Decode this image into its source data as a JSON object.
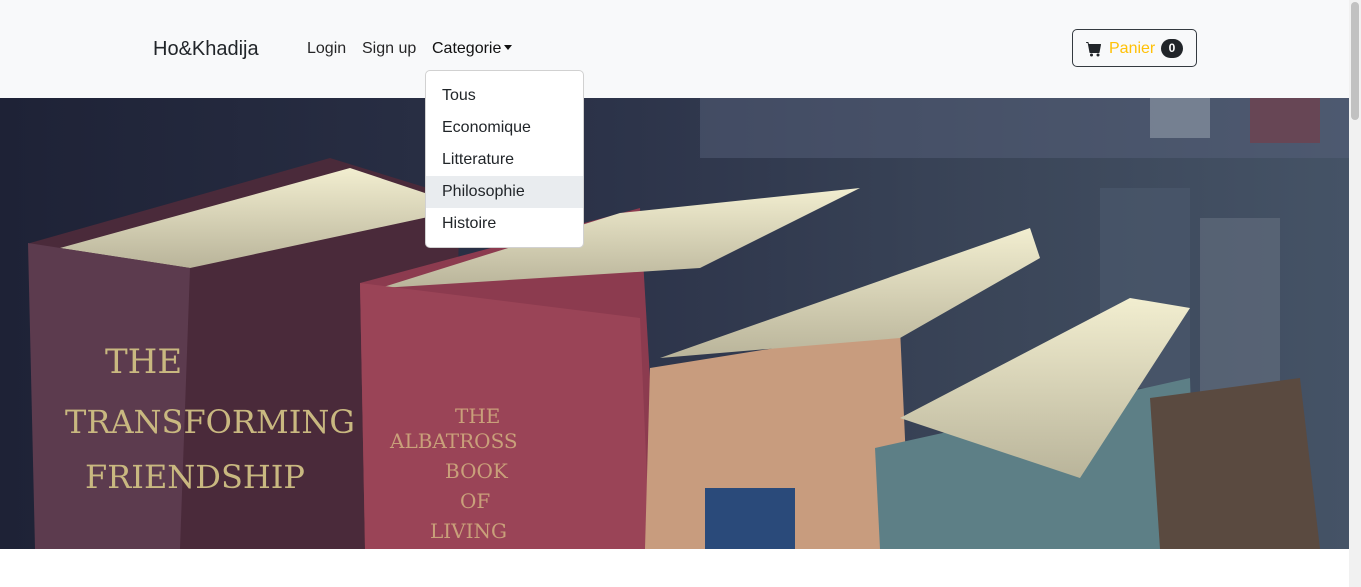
{
  "navbar": {
    "brand": "Ho&Khadija",
    "links": {
      "login": "Login",
      "signup": "Sign up",
      "categorie": "Categorie"
    },
    "cart": {
      "label": "Panier",
      "count": "0",
      "icon": "cart-icon"
    }
  },
  "dropdown": {
    "items": [
      {
        "label": "Tous"
      },
      {
        "label": "Economique"
      },
      {
        "label": "Litterature"
      },
      {
        "label": "Philosophie",
        "highlighted": true
      },
      {
        "label": "Histoire"
      }
    ]
  },
  "hero": {
    "book_1": "THE TRANSFORMING FRIENDSHIP",
    "book_2": "THE ALBATROSS BOOK OF LIVING"
  },
  "colors": {
    "navbar_bg": "#f8f9fa",
    "cart_label": "#ffc107",
    "badge_bg": "#212529",
    "dropdown_highlight": "#e9ecef"
  }
}
